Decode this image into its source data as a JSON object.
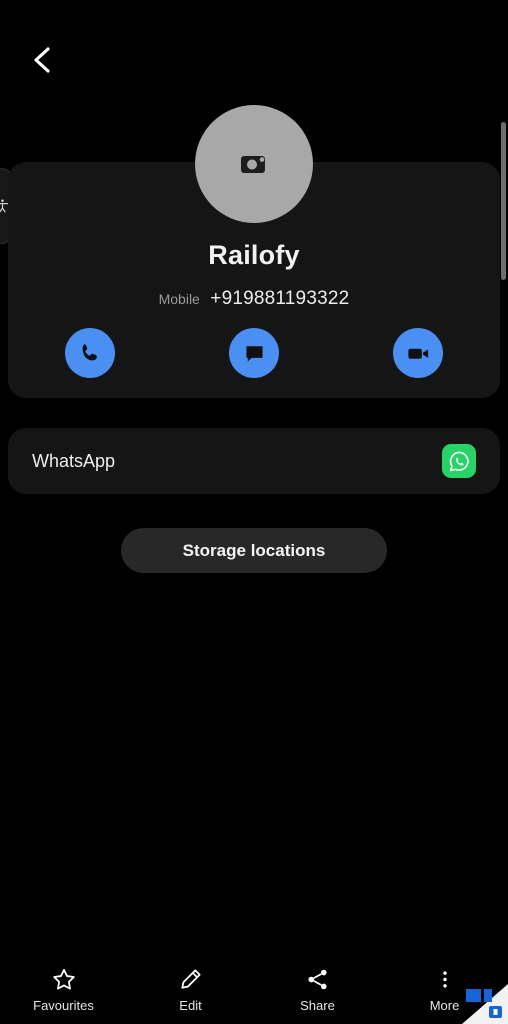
{
  "screen": {
    "title": "Contact details",
    "background_color": "#000000",
    "card_color": "#151515",
    "accent_blue": "#4a90f2",
    "whatsapp_green": "#25D366"
  },
  "topbar": {
    "back_label": "Back",
    "back_icon": "chevron-left-icon"
  },
  "edge": {
    "accessibility_icon": "accessibility-person-icon",
    "scrollbar_name": "vertical-scrollbar"
  },
  "contact": {
    "avatar_icon": "camera-icon",
    "avatar_color": "#a8a8a8",
    "name": "Railofy",
    "number_label": "Mobile",
    "number": "+919881193322",
    "actions": [
      {
        "name": "call",
        "label": "Call",
        "icon": "phone-icon"
      },
      {
        "name": "message",
        "label": "Message",
        "icon": "message-bubble-icon"
      },
      {
        "name": "video-call",
        "label": "Video call",
        "icon": "video-camera-icon"
      }
    ]
  },
  "whatsapp": {
    "label": "WhatsApp",
    "icon": "whatsapp-icon"
  },
  "storage": {
    "label": "Storage locations"
  },
  "bottom_nav": {
    "items": [
      {
        "label": "Favourites",
        "icon": "star-outline-icon"
      },
      {
        "label": "Edit",
        "icon": "pencil-icon"
      },
      {
        "label": "Share",
        "icon": "share-nodes-icon"
      },
      {
        "label": "More",
        "icon": "more-vertical-dots-icon"
      }
    ]
  },
  "watermark": {
    "name": "corner-logo-watermark",
    "color": "#1565d8"
  }
}
